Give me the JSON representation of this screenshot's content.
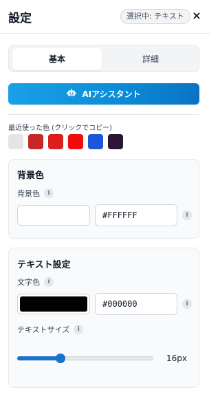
{
  "header": {
    "title": "設定",
    "selection_badge": "選択中: テキスト",
    "close_glyph": "×"
  },
  "tabs": [
    {
      "label": "基本",
      "active": true
    },
    {
      "label": "詳細",
      "active": false
    }
  ],
  "ai_button": {
    "label": "AIアシスタント",
    "icon": "robot-icon"
  },
  "recent_colors": {
    "label": "最近使った色 (クリックでコピー)",
    "colors": [
      "#E5E5E5",
      "#C62828",
      "#DC1E1E",
      "#F20B0B",
      "#1E56D8",
      "#2D1633"
    ]
  },
  "background_panel": {
    "title": "背景色",
    "field_label": "背景色",
    "info_glyph": "i",
    "color": "#FFFFFF",
    "hex_value": "#FFFFFF"
  },
  "text_panel": {
    "title": "テキスト設定",
    "color_label": "文字色",
    "info_glyph": "i",
    "color": "#000000",
    "hex_value": "#000000",
    "size_label": "テキストサイズ",
    "size_value": "16px",
    "slider_fraction": 0.32
  },
  "accent_color": "#1A73C9"
}
